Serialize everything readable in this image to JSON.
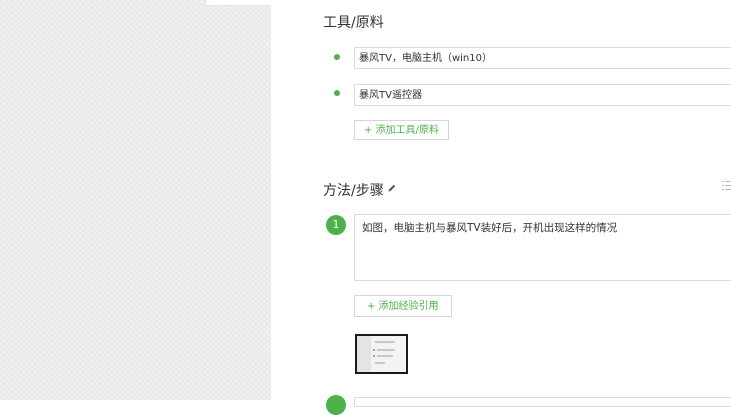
{
  "tools": {
    "title": "工具/原料",
    "items": [
      {
        "value": "暴风TV，电脑主机（win10）"
      },
      {
        "value": "暴风TV遥控器"
      }
    ],
    "add_label": "+ 添加工具/原料"
  },
  "method": {
    "title": "方法/步骤",
    "steps": [
      {
        "number": "1",
        "text": "如图，电脑主机与暴风TV装好后，开机出现这样的情况"
      }
    ],
    "add_ref_label": "+ 添加经验引用"
  },
  "colors": {
    "accent": "#4cb14c",
    "border": "#dcdcdc",
    "left_background": "#ececec"
  },
  "icons": {
    "edit": "pencil-icon",
    "list": "list-icon",
    "bullet": "bullet-dot-icon"
  }
}
